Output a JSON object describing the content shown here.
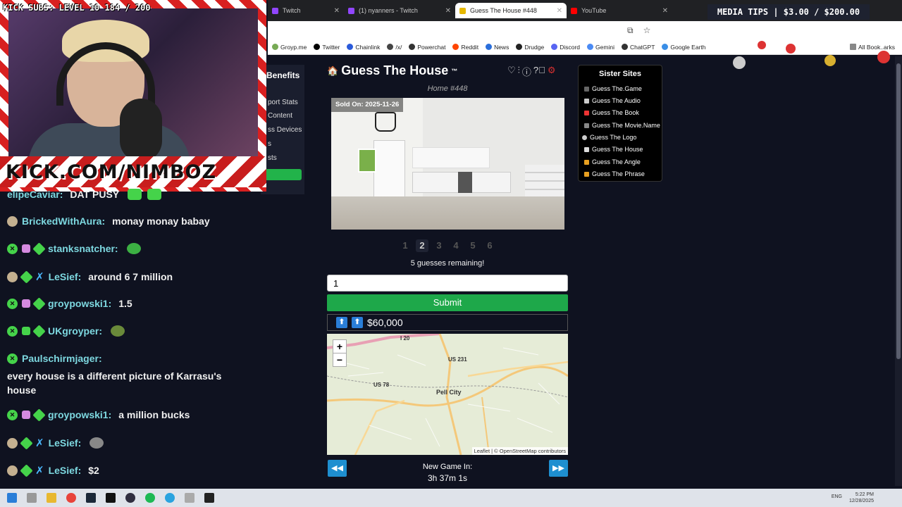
{
  "stream": {
    "subs_label": "KICK SUBS: LEVEL 10 184 / 200",
    "banner_text": "KICK.COM/NIMBOZ",
    "media_tips": "MEDIA TIPS | $3.00 / $200.00"
  },
  "browser": {
    "tabs": [
      {
        "label": "Twitch",
        "color": "#9146ff"
      },
      {
        "label": "(1) nyanners - Twitch",
        "color": "#9146ff"
      },
      {
        "label": "Guess The House #448",
        "color": "#e6b800",
        "active": true
      },
      {
        "label": "YouTube",
        "color": "#ff0000"
      }
    ],
    "bookmarks": [
      {
        "label": "Groyp.me",
        "color": "#7a5"
      },
      {
        "label": "Twitter",
        "color": "#000"
      },
      {
        "label": "Chainlink",
        "color": "#2a5ada"
      },
      {
        "label": "/x/",
        "color": "#444"
      },
      {
        "label": "Powerchat",
        "color": "#333"
      },
      {
        "label": "Reddit",
        "color": "#ff4500"
      },
      {
        "label": "News",
        "color": "#2a6edb"
      },
      {
        "label": "Drudge",
        "color": "#222"
      },
      {
        "label": "Discord",
        "color": "#5865f2"
      },
      {
        "label": "Gemini",
        "color": "#4a8af4"
      },
      {
        "label": "ChatGPT",
        "color": "#333"
      },
      {
        "label": "Google Earth",
        "color": "#3a8ee6"
      }
    ],
    "bookmarks_all": "All Book..arks"
  },
  "benefits": {
    "title": "Benefits",
    "items": [
      "port Stats",
      "Content",
      "ss Devices",
      "s",
      "sts"
    ]
  },
  "chat": {
    "messages": [
      {
        "user": "elipeCaviar:",
        "text": "DAT PUSY",
        "user_color": "#7dd8e0",
        "badges": []
      },
      {
        "user": "BrickedWithAura:",
        "text": "monay monay babay",
        "user_color": "#7dd8e0",
        "badges": [
          "avatar"
        ]
      },
      {
        "user": "stanksnatcher:",
        "text": "",
        "user_color": "#7dd8e0",
        "badges": [
          "x",
          "gift",
          "diamond"
        ]
      },
      {
        "user": "LeSief:",
        "text": "around 6 7 million",
        "user_color": "#7dd8e0",
        "badges": [
          "avatar",
          "diamond",
          "sword"
        ]
      },
      {
        "user": "groypowski1:",
        "text": "1.5",
        "user_color": "#7dd8e0",
        "badges": [
          "x",
          "gift",
          "diamond"
        ]
      },
      {
        "user": "UKgroyper:",
        "text": "",
        "user_color": "#7dd8e0",
        "badges": [
          "x",
          "gift",
          "diamond"
        ]
      },
      {
        "user": "Paulschirmjager:",
        "text": "every house is a different picture of Karrasu's house",
        "user_color": "#7dd8e0",
        "badges": [
          "x"
        ]
      },
      {
        "user": "groypowski1:",
        "text": "a million bucks",
        "user_color": "#7dd8e0",
        "badges": [
          "x",
          "gift",
          "diamond"
        ]
      },
      {
        "user": "LeSief:",
        "text": "",
        "user_color": "#7dd8e0",
        "badges": [
          "avatar",
          "diamond",
          "sword"
        ]
      },
      {
        "user": "LeSief:",
        "text": "$2",
        "user_color": "#7dd8e0",
        "badges": [
          "avatar",
          "diamond",
          "sword"
        ]
      }
    ]
  },
  "game": {
    "title": "Guess The House",
    "trademark": "™",
    "home_number": "Home #448",
    "sold_on": "Sold On: 2025-11-26",
    "photo_pages": [
      "1",
      "2",
      "3",
      "4",
      "5",
      "6"
    ],
    "active_page": 2,
    "viewed_pages": [
      1,
      2
    ],
    "guesses_remaining": "5 guesses remaining!",
    "guess_value": "1",
    "submit_label": "Submit",
    "previous_guess": "$60,000",
    "new_game_label": "New Game In:",
    "new_game_timer": "3h 37m 1s",
    "map": {
      "labels": [
        "Pell City",
        "US 231",
        "US 78",
        "I 20"
      ],
      "zoom_in": "+",
      "zoom_out": "−",
      "attribution": "Leaflet | © OpenStreetMap contributors"
    }
  },
  "sister_sites": {
    "title": "Sister Sites",
    "items": [
      {
        "label": "Guess The.Game",
        "color": "#666"
      },
      {
        "label": "Guess The Audio",
        "color": "#ccc"
      },
      {
        "label": "Guess The Book",
        "color": "#e33"
      },
      {
        "label": "Guess The Movie.Name",
        "color": "#888"
      },
      {
        "label": "Guess The Logo",
        "color": "#ccc"
      },
      {
        "label": "Guess The House",
        "color": "#ddd"
      },
      {
        "label": "Guess The Angle",
        "color": "#e8a020"
      },
      {
        "label": "Guess The Phrase",
        "color": "#e8a020"
      }
    ]
  },
  "taskbar": {
    "lang": "ENG",
    "time": "5:22 PM",
    "date": "12/28/2025"
  }
}
